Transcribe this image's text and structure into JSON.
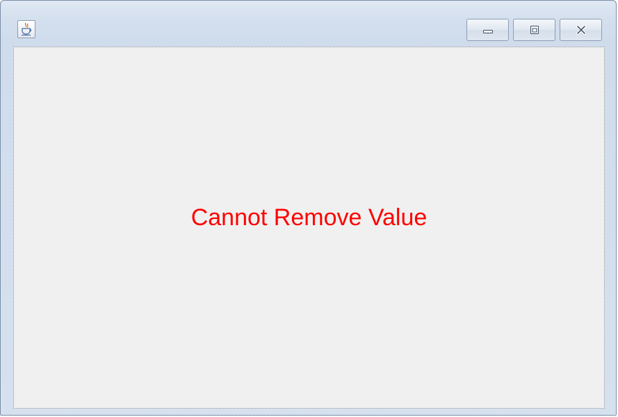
{
  "window": {
    "message": "Cannot Remove Value",
    "message_color": "#ff0000",
    "icons": {
      "app": "java-app-icon",
      "minimize": "minimize-icon",
      "maximize": "maximize-icon",
      "close": "close-icon"
    }
  }
}
